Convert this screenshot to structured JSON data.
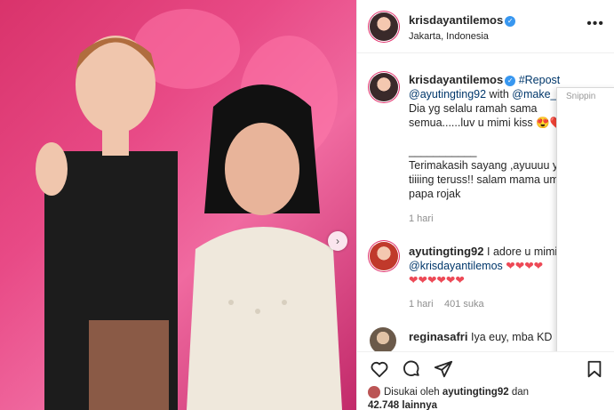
{
  "post": {
    "author": "krisdayantilemos",
    "location": "Jakarta, Indonesia"
  },
  "caption": {
    "author": "krisdayantilemos",
    "repost_tag": "#Repost",
    "mention1": "@ayutingting92",
    "with_text": "with",
    "mention2": "@make_repos",
    "line1": "Dia yg selalu ramah sama",
    "line2": "semua......luv u mimi kiss",
    "line2_emoji": "😍❤️🥰",
    "separator": "___________",
    "line3": "Terimakasih sayang ,ayuuuu yg ting",
    "line4": "tiiiing teruss!! salam mama umi &",
    "line5": "papa rojak",
    "time": "1 hari"
  },
  "comment1": {
    "author": "ayutingting92",
    "text": "I adore u mimi",
    "mention": "@krisdayantilemos",
    "hearts1": "❤❤❤❤",
    "hearts2": "❤❤❤❤❤❤",
    "time": "1 hari",
    "likes": "401 suka"
  },
  "comment2": {
    "author": "reginasafri",
    "text": "Iya euy, mba KD"
  },
  "snip": {
    "label": "Snippin"
  },
  "likes": {
    "prefix": "Disukai oleh",
    "user": "ayutingting92",
    "suffix": "dan",
    "count": "42.748 lainnya"
  },
  "colors": {
    "accent": "#3897f0",
    "heart": "#ed4956",
    "mention": "#00376b"
  }
}
